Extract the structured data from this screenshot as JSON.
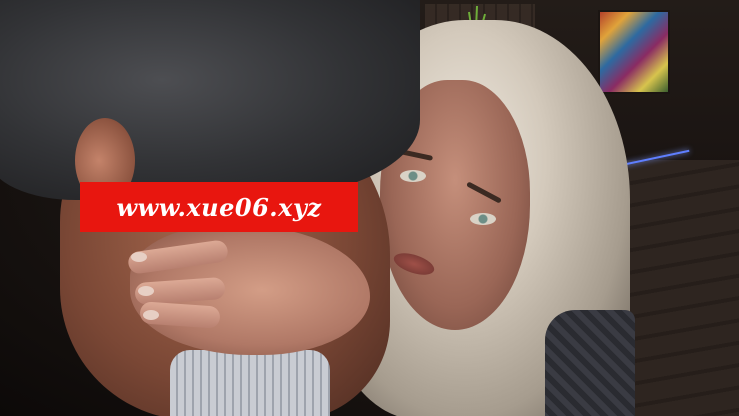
{
  "scene": {
    "description_icon": "game-cg-scene",
    "watermark": {
      "text": "www.xue06.xyz",
      "background_color": "#e8160f",
      "text_color": "#ffffff"
    },
    "accent_light_color": "#5f7fff"
  }
}
